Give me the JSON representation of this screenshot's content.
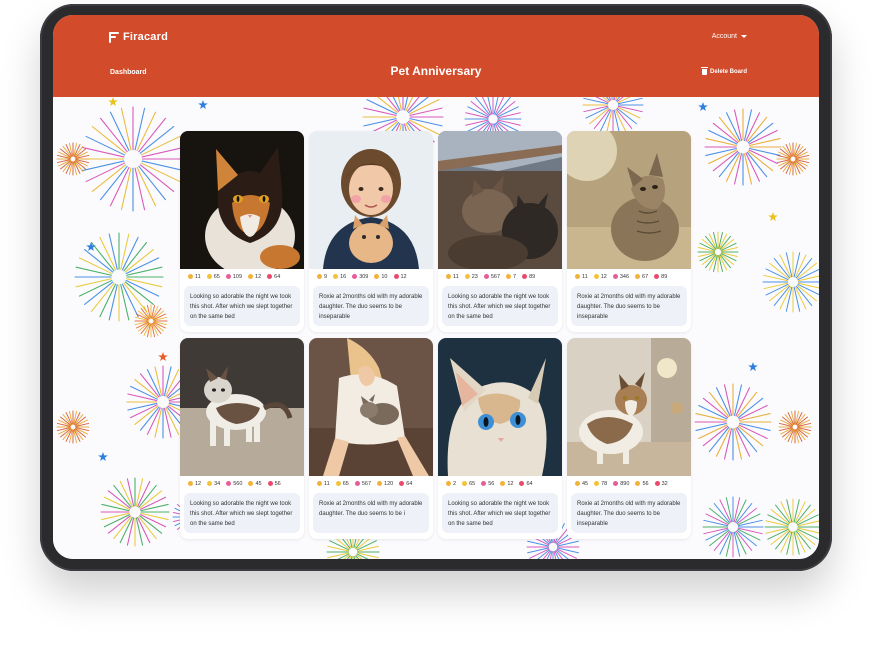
{
  "header": {
    "logo": "Firacard",
    "account_label": "Account",
    "nav_dashboard": "Dashboard",
    "board_title": "Pet Anniversary",
    "delete_label": "Delete Board"
  },
  "colors": {
    "header_bg": "#d24b2a",
    "device_frame": "#2b2b2e"
  },
  "reaction_icons": [
    "thumbs-up-icon",
    "laughing-face-icon",
    "party-popper-icon",
    "grinning-face-icon",
    "heart-icon"
  ],
  "cards": [
    {
      "photo": "calico-cat-dark-background",
      "reactions": [
        "11",
        "65",
        "109",
        "12",
        "64"
      ],
      "caption": "Looking so adorable the night we took this shot. After which we slept together on the same bed"
    },
    {
      "photo": "girl-holding-fluffy-kitten",
      "reactions": [
        "9",
        "16",
        "309",
        "10",
        "12"
      ],
      "caption": "Roxie at 2months old with my adorable daughter. The duo seems to be inseparable"
    },
    {
      "photo": "two-cats-on-rooftop",
      "reactions": [
        "11",
        "23",
        "567",
        "7",
        "89"
      ],
      "caption": "Looking so adorable the night we took this shot. After which we slept together on the same bed"
    },
    {
      "photo": "tabby-cat-looking-up-in-sun",
      "reactions": [
        "11",
        "12",
        "346",
        "67",
        "89"
      ],
      "caption": "Roxie at 2months old with my adorable daughter. The duo seems to be inseparable"
    },
    {
      "photo": "calico-cat-walking-on-sand",
      "reactions": [
        "12",
        "34",
        "560",
        "45",
        "56"
      ],
      "caption": "Looking so adorable the night we took this shot. After which we slept together on the same bed"
    },
    {
      "photo": "woman-with-cat-on-lap",
      "reactions": [
        "11",
        "65",
        "567",
        "120",
        "64"
      ],
      "caption": "Roxie at 2months old with my adorable daughter. The duo seems to be i"
    },
    {
      "photo": "blue-eyed-cat-closeup",
      "reactions": [
        "2",
        "65",
        "56",
        "12",
        "64"
      ],
      "caption": "Looking so adorable the night we took this shot. After which we slept together on the same bed"
    },
    {
      "photo": "calico-cat-in-room",
      "reactions": [
        "45",
        "78",
        "890",
        "56",
        "32"
      ],
      "caption": "Roxie at 2months old with my adorable daughter. The duo seems to be inseparable"
    }
  ]
}
